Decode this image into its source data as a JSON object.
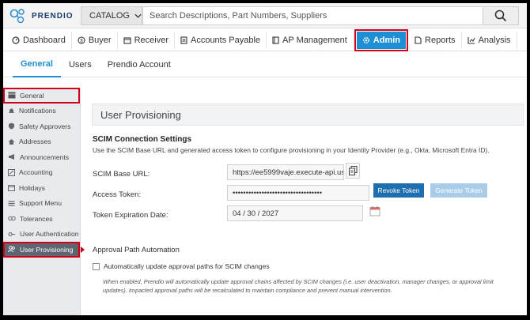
{
  "app": {
    "logo_text": "PRENDIO"
  },
  "header": {
    "catalog_label": "CATALOG",
    "search_placeholder": "Search Descriptions, Part Numbers, Suppliers"
  },
  "nav": [
    {
      "label": "Dashboard",
      "icon": "dashboard-icon"
    },
    {
      "label": "Buyer",
      "icon": "dollar-icon"
    },
    {
      "label": "Receiver",
      "icon": "receiver-icon"
    },
    {
      "label": "Accounts Payable",
      "icon": "document-icon"
    },
    {
      "label": "AP Management",
      "icon": "folder-icon"
    },
    {
      "label": "Admin",
      "icon": "gear-icon",
      "active": true
    },
    {
      "label": "Reports",
      "icon": "report-icon"
    },
    {
      "label": "Analysis",
      "icon": "chart-icon"
    }
  ],
  "subtabs": [
    {
      "label": "General",
      "active": true
    },
    {
      "label": "Users"
    },
    {
      "label": "Prendio Account"
    }
  ],
  "sidebar": [
    {
      "label": "General",
      "icon": "table-icon",
      "highlight": true
    },
    {
      "label": "Notifications",
      "icon": "bell-icon"
    },
    {
      "label": "Safety Approvers",
      "icon": "shield-icon"
    },
    {
      "label": "Addresses",
      "icon": "home-icon"
    },
    {
      "label": "Announcements",
      "icon": "megaphone-icon"
    },
    {
      "label": "Accounting",
      "icon": "accounting-icon"
    },
    {
      "label": "Holidays",
      "icon": "calendar-icon"
    },
    {
      "label": "Support Menu",
      "icon": "menu-icon"
    },
    {
      "label": "Tolerances",
      "icon": "tolerance-icon"
    },
    {
      "label": "User Authentication",
      "icon": "key-icon"
    },
    {
      "label": "User Provisioning",
      "icon": "users-icon",
      "selected": true,
      "highlight": true
    }
  ],
  "main": {
    "title": "User Provisioning",
    "scim_heading": "SCIM Connection Settings",
    "scim_desc": "Use the SCIM Base URL and generated access token to configure provisioning in your Identity Provider (e.g., Okta, Microsoft Entra ID).",
    "base_url_label": "SCIM Base URL:",
    "base_url_value": "https://ee5999vaje.execute-api.us-",
    "token_label": "Access Token:",
    "token_value": "••••••••••••••••••••••••••••••••••",
    "expiration_label": "Token Expiration Date:",
    "expiration_value": "04 / 30 / 2027",
    "revoke_label": "Revoke Token",
    "generate_label": "Generate Token",
    "approval_heading": "Approval Path Automation",
    "checkbox_label": "Automatically update approval paths for SCIM changes",
    "note": "When enabled, Prendio will automatically update approval chains affected by SCIM changes (i.e. user deactivation, manager changes, or approval limit updates). Impacted approval paths will be recalculated to maintain compliance and prevent manual intervention."
  },
  "colors": {
    "accent": "#1e8fd4",
    "highlight": "#d0021b",
    "revoke": "#1e6fb0",
    "generate_disabled": "#a9cde8"
  }
}
